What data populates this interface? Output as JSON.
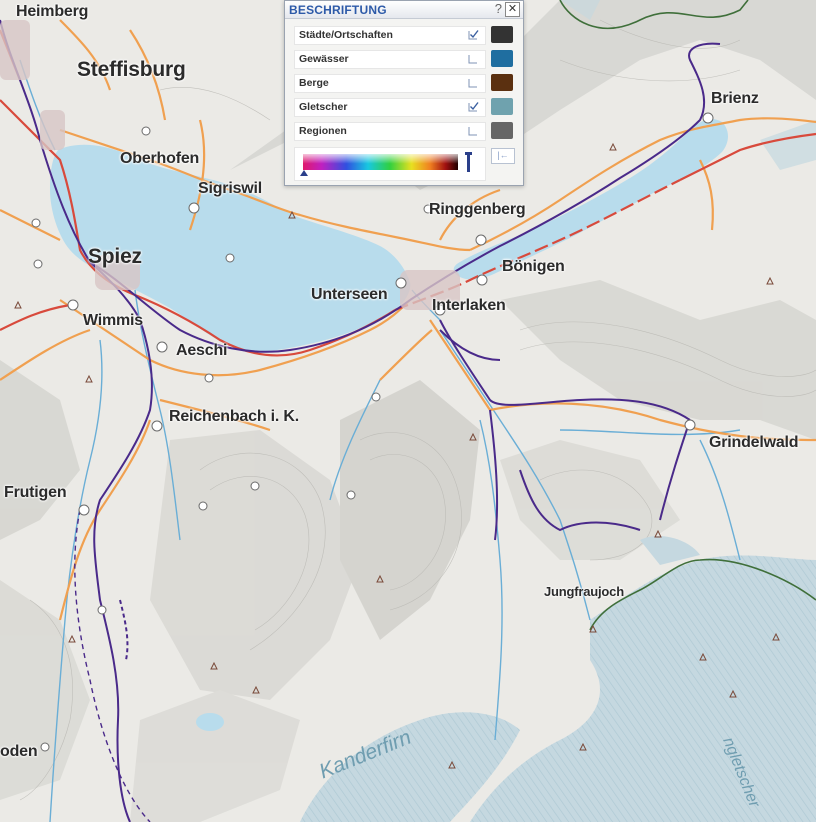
{
  "panel": {
    "title": "BESCHRIFTUNG",
    "help": "?",
    "close": "✕",
    "reset": "|←",
    "layers": [
      {
        "name": "Städte/Ortschaften",
        "checked": true,
        "color": "#333333"
      },
      {
        "name": "Gewässer",
        "checked": false,
        "color": "#1f6ea0"
      },
      {
        "name": "Berge",
        "checked": false,
        "color": "#5b3010"
      },
      {
        "name": "Gletscher",
        "checked": true,
        "color": "#6fa2ae"
      },
      {
        "name": "Regionen",
        "checked": false,
        "color": "#666666"
      }
    ]
  },
  "places": {
    "heimberg": "Heimberg",
    "steffisburg": "Steffisburg",
    "oberhofen": "Oberhofen",
    "sigriswil": "Sigriswil",
    "spiez": "Spiez",
    "wimmis": "Wimmis",
    "aeschi": "Aeschi",
    "unterseen": "Unterseen",
    "interlaken": "Interlaken",
    "ringgenberg": "Ringgenberg",
    "boenigen": "Bönigen",
    "brienz": "Brienz",
    "reichenbach": "Reichenbach i. K.",
    "frutigen": "Frutigen",
    "grindelwald": "Grindelwald",
    "jungfraujoch": "Jungfraujoch",
    "oden": "oden"
  },
  "glaciers": {
    "kanderfirn": "Kanderfirn",
    "aletsch": "ngletscher"
  },
  "colors": {
    "lake": "#b8dcec",
    "road_main": "#f0a050",
    "road_red": "#d84a3c",
    "rail": "#4a2a8a",
    "river": "#6aaed6",
    "glacier": "#c8dde6"
  }
}
